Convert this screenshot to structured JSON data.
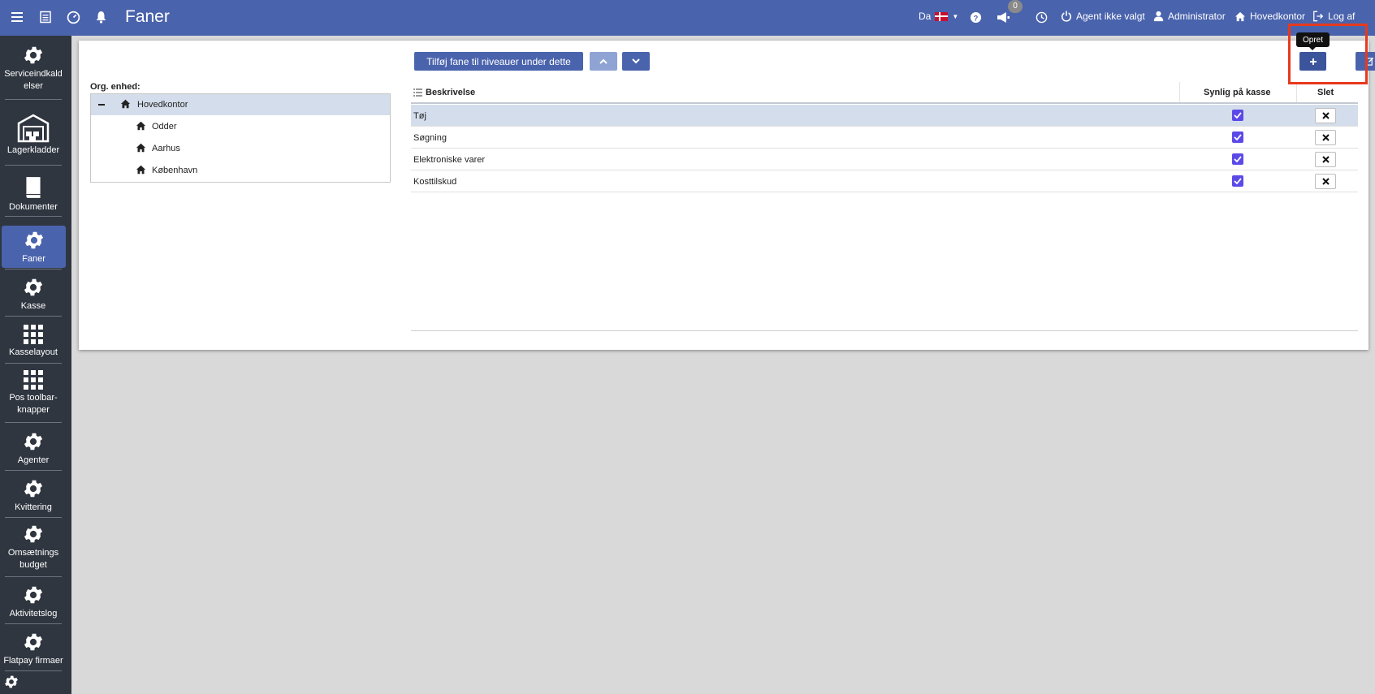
{
  "header": {
    "title": "Faner",
    "language": "Da",
    "notifications_count": "0",
    "agent_status": "Agent ikke valgt",
    "user": "Administrator",
    "location": "Hovedkontor",
    "logout": "Log af"
  },
  "sidebar": {
    "items": [
      {
        "label": "Serviceindkald elser",
        "icon": "gear-icon"
      },
      {
        "label": "Lagerkladder",
        "icon": "warehouse-icon"
      },
      {
        "label": "Dokumenter",
        "icon": "book-icon"
      },
      {
        "label": "Faner",
        "icon": "gear-icon",
        "active": true
      },
      {
        "label": "Kasse",
        "icon": "gear-icon"
      },
      {
        "label": "Kasselayout",
        "icon": "grid-icon"
      },
      {
        "label": "Pos toolbar-knapper",
        "icon": "grid-icon"
      },
      {
        "label": "Agenter",
        "icon": "gear-icon"
      },
      {
        "label": "Kvittering",
        "icon": "gear-icon"
      },
      {
        "label": "Omsætnings budget",
        "icon": "gear-icon"
      },
      {
        "label": "Aktivitetslog",
        "icon": "gear-icon"
      },
      {
        "label": "Flatpay firmaer",
        "icon": "gear-icon"
      }
    ]
  },
  "org": {
    "label": "Org. enhed:",
    "nodes": [
      {
        "label": "Hovedkontor",
        "level": 0,
        "selected": true
      },
      {
        "label": "Odder",
        "level": 1
      },
      {
        "label": "Aarhus",
        "level": 1
      },
      {
        "label": "København",
        "level": 1
      }
    ]
  },
  "toolbar": {
    "add_to_sublevels": "Tilføj fane til niveauer under dette",
    "create_tooltip": "Opret"
  },
  "table": {
    "headers": {
      "description": "Beskrivelse",
      "visible": "Synlig på kasse",
      "delete": "Slet"
    },
    "rows": [
      {
        "description": "Tøj",
        "visible": true,
        "selected": true
      },
      {
        "description": "Søgning",
        "visible": true
      },
      {
        "description": "Elektroniske varer",
        "visible": true
      },
      {
        "description": "Kosttilskud",
        "visible": true
      }
    ]
  },
  "colors": {
    "primary": "#4a63ad",
    "sidebar": "#2f3640",
    "highlight": "#e6391e",
    "checkbox": "#5b49e8"
  }
}
